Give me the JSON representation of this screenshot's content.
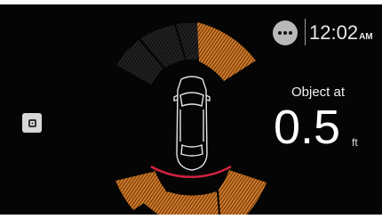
{
  "status_bar": {
    "options_icon": "more-horizontal-icon",
    "time": "12:02",
    "ampm": "AM"
  },
  "side_panel": {
    "button_icon": "camera-view-icon"
  },
  "parking_sensor": {
    "label": "Object at",
    "distance": "0.5",
    "unit": "ft",
    "colors": {
      "active_zone": "#d9822b",
      "inactive_zone": "#2a2a2a",
      "proximity_line": "#d2233e",
      "vehicle_outline": "#e6e6e6"
    },
    "front_zones_active": [
      false,
      false,
      false,
      true
    ],
    "rear_zones_active": [
      true,
      true,
      true,
      true
    ]
  }
}
